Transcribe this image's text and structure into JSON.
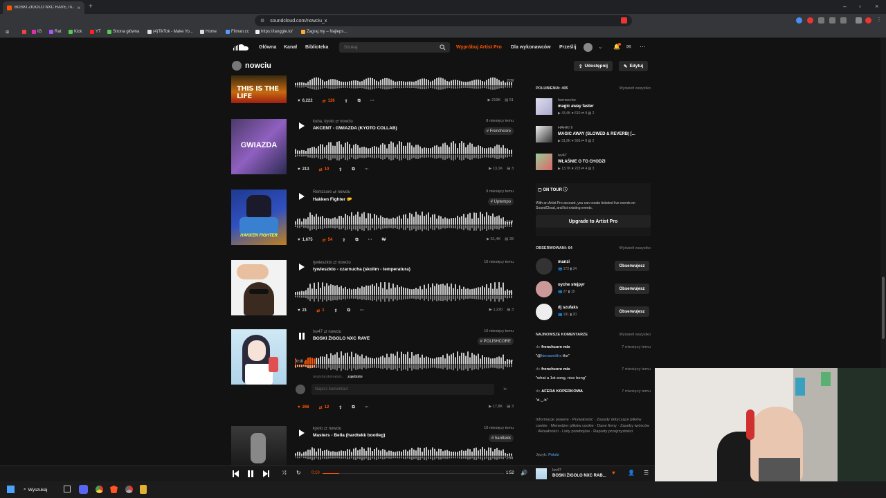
{
  "browser": {
    "tab_title": "BOSKI ŻIGOLO NXC RAVE, In...",
    "url": "soundcloud.com/nowciu_x",
    "bookmarks": [
      "IG",
      "Rat",
      "Kick",
      "YT",
      "Strona główna",
      "(4)TikTok - Make Yo...",
      "Home",
      "Filman.cc",
      "https://tanggle.io/",
      "Zagraj.my – Najleps..."
    ]
  },
  "header": {
    "nav": [
      "Główna",
      "Kanał",
      "Biblioteka"
    ],
    "search_placeholder": "Szukaj",
    "artist_pro": "Wypróbuj Artist Pro",
    "for_artists": "Dla wykonawców",
    "upload": "Prześlij"
  },
  "profile": {
    "name": "nowciu",
    "share": "Udostępnij",
    "edit": "Edytuj"
  },
  "tracks": [
    {
      "cover_text": "THIS IS THE LIFE",
      "likes": "6,222",
      "reposts": "126",
      "plays": "219K",
      "comments": "51",
      "duration": "2:09"
    },
    {
      "artist": "kuba, kyoto",
      "reposter": "nowciu",
      "title": "AKCENT - GWIAZDA (KYOTO COLLAB)",
      "date": "8 miesięcy temu",
      "tag": "# Frenchcore",
      "likes": "213",
      "reposts": "10",
      "plays": "13,1K",
      "comments": "3",
      "cover_text": "GWIAZDA"
    },
    {
      "artist": "Remzcore",
      "reposter": "nowciu",
      "title": "Hakken Fighter 🤛",
      "date": "9 miesięcy temu",
      "tag": "# Uptempo",
      "likes": "1,675",
      "reposts": "54",
      "plays": "51,4K",
      "comments": "28",
      "duration": "2:19",
      "cover_text": "HAKKEN FIGHTER"
    },
    {
      "artist": "tywieszkto",
      "reposter": "nowciu",
      "title": "tywieszkto - czarnucha (skolim - temperatura)",
      "date": "10 miesięcy temu",
      "likes": "21",
      "reposts": "1",
      "plays": "1,220",
      "comments": "3",
      "duration": "1:01"
    },
    {
      "artist": "lxv47",
      "reposter": "nowciu",
      "title": "BOSKI ŻIGOLO NXC RAVE",
      "date": "10 miesięcy temu",
      "tag": "# POLISHCORE",
      "likes": "266",
      "reposts": "12",
      "plays": "17,8K",
      "comments": "3",
      "elapsed": "0:10",
      "duration": "1:52",
      "progress": 0.09,
      "comment_user": "twojstarykimalais..",
      "comment_text": "zajebiste",
      "comment_placeholder": "Napisz komentarz"
    },
    {
      "artist": "kyoto",
      "reposter": "nowciu",
      "title": "Masters - Bella (hardtekk bootleg)",
      "date": "10 miesięcy temu",
      "tag": "# hardtekk",
      "duration": "2:34"
    }
  ],
  "sidebar": {
    "likes_header": "POLUBIENIA: 405",
    "view_all": "Wyświetl wszystko",
    "likes": [
      {
        "artist": "hornsecho",
        "title": "magic away faster",
        "plays": "43,4K",
        "likes": "610",
        "reposts": "9",
        "comments": "2"
      },
      {
        "artist": "HAHKI II",
        "title": "MAGIC AWAY (SLOWED & REVERB) [...",
        "plays": "31,9K",
        "likes": "566",
        "reposts": "8",
        "comments": "2"
      },
      {
        "artist": "lxv47",
        "title": "WŁAŚNIE O TO CHODZI",
        "plays": "13,7K",
        "likes": "223",
        "reposts": "4",
        "comments": "3"
      }
    ],
    "on_tour_title": "ON TOUR",
    "on_tour_text": "With an Artist Pro account, you can create ticketed live events on SoundCloud, and list existing events.",
    "upgrade": "Upgrade to Artist Pro",
    "following_header": "OBSERWOWANI: 64",
    "following": [
      {
        "name": "manzi",
        "followers": "173",
        "tracks": "34"
      },
      {
        "name": "oyche stejpyr",
        "followers": "27",
        "tracks": "18"
      },
      {
        "name": "dj szufaks",
        "followers": "191",
        "tracks": "20"
      }
    ],
    "follow_btn": "Obserwujesz",
    "comments_header": "NAJNOWSZE KOMENTARZE",
    "comments": [
      {
        "on": "frenchcore mix",
        "when": "7 miesięcy temu",
        "text_prefix": "\"@",
        "mention": "kierasmiths",
        "text_suffix": " thx\""
      },
      {
        "on": "frenchcore mix",
        "when": "7 miesięcy temu",
        "text": "\"what a 1st song, nice beng\""
      },
      {
        "on": "AFERA KOPERKOWA",
        "when": "7 miesięcy temu",
        "text": "\"d-_-b\""
      }
    ],
    "do": "do",
    "footer": "Informacje prawne · Prywatność · Zasady dotyczące plików cookie · Menedżer plików cookie · Dane firmy · Zasoby twórców · Aktualności · Listy przebojów · Raporty przejrzystości",
    "lang_label": "Język:",
    "lang": "Polski"
  },
  "player": {
    "elapsed": "0:10",
    "duration": "1:52",
    "progress": 0.09,
    "artist": "lxv47",
    "title": "BOSKI ŻIGOLO NXC RAB..."
  },
  "taskbar": {
    "search": "Wyszukaj"
  },
  "colors": {
    "accent": "#ff5500",
    "bg": "#121212",
    "panel": "#2a2a2a"
  }
}
